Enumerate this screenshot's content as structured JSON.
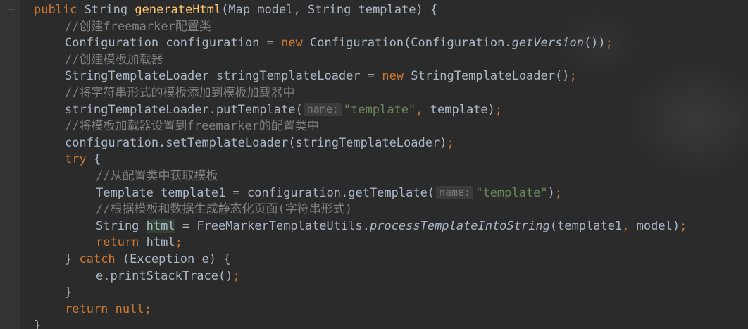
{
  "code_lines": [
    {
      "indent": 0,
      "tokens": [
        {
          "t": "public",
          "c": "kw"
        },
        {
          "t": " String ",
          "c": ""
        },
        {
          "t": "generateHtml",
          "c": "fn"
        },
        {
          "t": "(Map model, String template) {",
          "c": ""
        }
      ]
    },
    {
      "indent": 1,
      "tokens": [
        {
          "t": "//创建freemarker配置类",
          "c": "cm"
        }
      ]
    },
    {
      "indent": 1,
      "tokens": [
        {
          "t": "Configuration configuration = ",
          "c": ""
        },
        {
          "t": "new",
          "c": "kw"
        },
        {
          "t": " Configuration(Configuration.",
          "c": ""
        },
        {
          "t": "getVersion",
          "c": "it"
        },
        {
          "t": "())",
          "c": ""
        },
        {
          "t": ";",
          "c": "kw"
        }
      ]
    },
    {
      "indent": 1,
      "tokens": [
        {
          "t": "//创建模板加载器",
          "c": "cm"
        }
      ]
    },
    {
      "indent": 1,
      "tokens": [
        {
          "t": "StringTemplateLoader stringTemplateLoader = ",
          "c": ""
        },
        {
          "t": "new",
          "c": "kw"
        },
        {
          "t": " StringTemplateLoader()",
          "c": ""
        },
        {
          "t": ";",
          "c": "kw"
        }
      ]
    },
    {
      "indent": 1,
      "tokens": [
        {
          "t": "//将字符串形式的模板添加到模板加载器中",
          "c": "cm"
        }
      ]
    },
    {
      "indent": 1,
      "tokens": [
        {
          "t": "stringTemplateLoader.putTemplate(",
          "c": ""
        },
        {
          "t": "name:",
          "c": "hint"
        },
        {
          "t": "\"template\"",
          "c": "str"
        },
        {
          "t": ", ",
          "c": "kw"
        },
        {
          "t": "template)",
          "c": ""
        },
        {
          "t": ";",
          "c": "kw"
        }
      ]
    },
    {
      "indent": 1,
      "tokens": [
        {
          "t": "//将模板加载器设置到freemarker的配置类中",
          "c": "cm"
        }
      ]
    },
    {
      "indent": 1,
      "tokens": [
        {
          "t": "configuration.setTemplateLoader(stringTemplateLoader)",
          "c": ""
        },
        {
          "t": ";",
          "c": "kw"
        }
      ]
    },
    {
      "indent": 1,
      "tokens": [
        {
          "t": "try",
          "c": "kw"
        },
        {
          "t": " {",
          "c": ""
        }
      ]
    },
    {
      "indent": 2,
      "tokens": [
        {
          "t": "//从配置类中获取模板",
          "c": "cm"
        }
      ]
    },
    {
      "indent": 2,
      "tokens": [
        {
          "t": "Template template1 = configuration.getTemplate(",
          "c": ""
        },
        {
          "t": "name:",
          "c": "hint"
        },
        {
          "t": "\"template\"",
          "c": "str"
        },
        {
          "t": ")",
          "c": ""
        },
        {
          "t": ";",
          "c": "kw"
        }
      ]
    },
    {
      "indent": 2,
      "tokens": [
        {
          "t": "//根据模板和数据生成静态化页面(字符串形式)",
          "c": "cm"
        }
      ]
    },
    {
      "indent": 2,
      "tokens": [
        {
          "t": "String ",
          "c": ""
        },
        {
          "t": "html",
          "c": "hl"
        },
        {
          "t": " = FreeMarkerTemplateUtils.",
          "c": ""
        },
        {
          "t": "processTemplateIntoString",
          "c": "it"
        },
        {
          "t": "(template1",
          "c": ""
        },
        {
          "t": ", ",
          "c": "kw"
        },
        {
          "t": "model)",
          "c": ""
        },
        {
          "t": ";",
          "c": "kw"
        }
      ]
    },
    {
      "indent": 2,
      "tokens": [
        {
          "t": "return",
          "c": "kw"
        },
        {
          "t": " html",
          "c": ""
        },
        {
          "t": ";",
          "c": "kw"
        }
      ]
    },
    {
      "indent": 1,
      "tokens": [
        {
          "t": "} ",
          "c": ""
        },
        {
          "t": "catch",
          "c": "kw"
        },
        {
          "t": " (Exception e) {",
          "c": ""
        }
      ]
    },
    {
      "indent": 2,
      "tokens": [
        {
          "t": "e.printStackTrace()",
          "c": ""
        },
        {
          "t": ";",
          "c": "kw"
        }
      ]
    },
    {
      "indent": 1,
      "tokens": [
        {
          "t": "}",
          "c": ""
        }
      ]
    },
    {
      "indent": 1,
      "tokens": [
        {
          "t": "return",
          "c": "kw"
        },
        {
          "t": " ",
          "c": ""
        },
        {
          "t": "null",
          "c": "kw"
        },
        {
          "t": ";",
          "c": "kw"
        }
      ]
    },
    {
      "indent": 0,
      "tokens": [
        {
          "t": "}",
          "c": ""
        }
      ]
    }
  ],
  "theme": {
    "background": "#2b2b2b",
    "text": "#a9b7c6",
    "keyword": "#cc7832",
    "method_declaration": "#ffc66d",
    "comment": "#808080",
    "string": "#6a8759"
  }
}
